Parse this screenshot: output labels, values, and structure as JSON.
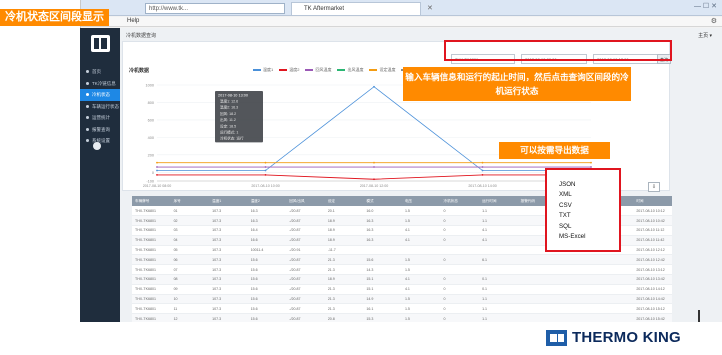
{
  "annotation": {
    "title": "冷机状态区间段显示",
    "callout_filters": "输入车辆信息和运行的起止时间，然后点击查询区间段的冷机运行状态",
    "callout_export": "可以按需导出数据"
  },
  "browser": {
    "tab_title": "TK Aftermarket",
    "menu_help": "Help",
    "address": "http://www.tk..."
  },
  "sidebar": {
    "items": [
      {
        "label": "首页"
      },
      {
        "label": "TK冷链信息"
      },
      {
        "label": "冷机状态"
      },
      {
        "label": "车辆运行状态"
      },
      {
        "label": "运营统计"
      },
      {
        "label": "报警查询"
      },
      {
        "label": "系统设置"
      }
    ],
    "active_index": 2
  },
  "page": {
    "title": "冷机数据查询",
    "top_right": "主页 ▾",
    "chart_title": "冷机数据",
    "filters": {
      "vehicle": "THX-TK6801",
      "start": "2017-08-10 08:00",
      "end": "2017-08-10 17:00"
    },
    "query_label": "查询",
    "export_label": "⇩"
  },
  "legend": [
    {
      "label": "温度1",
      "color": "#4a90d9"
    },
    {
      "label": "温度2",
      "color": "#e0151f"
    },
    {
      "label": "回风温度",
      "color": "#9b59b6"
    },
    {
      "label": "出风温度",
      "color": "#2bb673"
    },
    {
      "label": "设定温度",
      "color": "#f39c12"
    },
    {
      "label": "运行模式",
      "color": "#888888"
    }
  ],
  "chart_data": {
    "type": "line",
    "x": [
      "2017-08-10 08:00",
      "2017-08-10 10:00",
      "2017-08-10 12:00",
      "2017-08-10 14:00",
      "2017-08-10 17:00"
    ],
    "ylim": [
      -100,
      1000
    ],
    "yticks": [
      1000,
      800,
      600,
      400,
      200,
      0,
      -100
    ],
    "series": [
      {
        "name": "温度1",
        "values": [
          20,
          20,
          980,
          20,
          20
        ]
      },
      {
        "name": "温度2",
        "values": [
          -30,
          -30,
          -80,
          -30,
          -30
        ]
      },
      {
        "name": "回风温度",
        "values": [
          60,
          60,
          60,
          60,
          60
        ]
      },
      {
        "name": "设定温度",
        "values": [
          110,
          110,
          110,
          110,
          110
        ]
      }
    ],
    "tooltip": {
      "title": "2017-08-10 13:00",
      "lines": [
        "温度1: 12.6",
        "温度2: 16.3",
        "回风: 18.2",
        "出风: 11.2",
        "设定: 18.5",
        "运行模式: 1",
        "冷机状态: 运行"
      ]
    }
  },
  "table": {
    "columns": [
      "车辆牌号",
      "序号",
      "温度1",
      "温度2",
      "回风/出风",
      "设定",
      "模式",
      "电压",
      "冷机状态",
      "运行时间",
      "报警代码",
      "SP",
      "SP2",
      "时间"
    ],
    "rows": [
      [
        "THX-TK6801",
        "01",
        "107.3",
        "16.3",
        "-/20.87",
        "20.1",
        "16.0",
        "1.5",
        "0",
        "1.1",
        "",
        "",
        "",
        "2017-08-10 10:12"
      ],
      [
        "THX-TK6801",
        "02",
        "107.3",
        "16.3",
        "-/20.87",
        "18.9",
        "16.3",
        "1.5",
        "0",
        "1.1",
        "",
        "",
        "",
        "2017-08-10 10:42"
      ],
      [
        "THX-TK6801",
        "03",
        "107.3",
        "16.4",
        "-/20.87",
        "18.9",
        "16.3",
        "4.1",
        "0",
        "4.1",
        "",
        "",
        "",
        "2017-08-10 11:12"
      ],
      [
        "THX-TK6801",
        "04",
        "107.3",
        "16.6",
        "-/20.87",
        "18.9",
        "16.3",
        "4.1",
        "0",
        "4.1",
        "",
        "",
        "",
        "2017-08-10 11:42"
      ],
      [
        "THX-TK6801",
        "05",
        "107.3",
        "10011.4",
        "-/20.91",
        "-11.7",
        "",
        "",
        "",
        "",
        "",
        "",
        "",
        "2017-08-10 12:12"
      ],
      [
        "THX-TK6801",
        "06",
        "107.3",
        "15.6",
        "-/20.87",
        "21.3",
        "15.6",
        "1.5",
        "0",
        "6.1",
        "",
        "",
        "",
        "2017-08-10 12:42"
      ],
      [
        "THX-TK6801",
        "07",
        "107.3",
        "15.6",
        "-/20.87",
        "21.3",
        "14.3",
        "1.5",
        "",
        "",
        "",
        "",
        "",
        "2017-08-10 13:12"
      ],
      [
        "THX-TK6801",
        "08",
        "107.3",
        "15.6",
        "-/20.87",
        "18.9",
        "15.1",
        "4.1",
        "0",
        "0.1",
        "",
        "",
        "",
        "2017-08-10 13:42"
      ],
      [
        "THX-TK6801",
        "09",
        "107.3",
        "15.6",
        "-/20.87",
        "21.3",
        "15.1",
        "4.1",
        "0",
        "0.1",
        "",
        "",
        "",
        "2017-08-10 14:12"
      ],
      [
        "THX-TK6801",
        "10",
        "107.3",
        "15.6",
        "-/20.87",
        "21.3",
        "14.9",
        "1.5",
        "0",
        "1.1",
        "",
        "",
        "",
        "2017-08-10 14:42"
      ],
      [
        "THX-TK6801",
        "11",
        "107.3",
        "15.6",
        "-/20.87",
        "21.3",
        "16.1",
        "1.5",
        "0",
        "1.1",
        "",
        "",
        "",
        "2017-08-10 15:12"
      ],
      [
        "THX-TK6801",
        "12",
        "107.3",
        "15.6",
        "-/20.87",
        "20.8",
        "15.3",
        "1.5",
        "0",
        "1.1",
        "",
        "",
        "",
        "2017-08-10 15:42"
      ]
    ]
  },
  "export_menu": {
    "options": [
      "JSON",
      "XML",
      "CSV",
      "TXT",
      "SQL",
      "MS-Excel"
    ]
  },
  "brand": {
    "name": "THERMO KING"
  }
}
